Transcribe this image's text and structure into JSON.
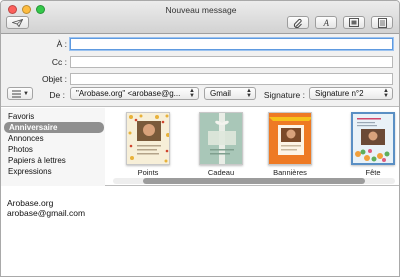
{
  "window": {
    "title": "Nouveau message"
  },
  "toolbar": {
    "send_icon": "paper-plane-icon",
    "attach_icon": "paperclip-icon",
    "format_icon": "font-a-icon",
    "photo_icon": "photo-browser-icon",
    "template_icon": "stationery-icon"
  },
  "fields": {
    "to_label": "À :",
    "cc_label": "Cc :",
    "subject_label": "Objet :",
    "to_value": "",
    "cc_value": "",
    "subject_value": "",
    "from_label": "De :",
    "from_value": "\"Arobase.org\" <arobase@g...",
    "account_value": "Gmail",
    "signature_label": "Signature :",
    "signature_value": "Signature n°2"
  },
  "stationery": {
    "categories": [
      "Favoris",
      "Anniversaire",
      "Annonces",
      "Photos",
      "Papiers à lettres",
      "Expressions"
    ],
    "selected_category": "Anniversaire",
    "templates": [
      "Points",
      "Cadeau",
      "Bannières",
      "Fête"
    ]
  },
  "message": {
    "signature_lines": [
      "Arobase.org",
      "arobase@gmail.com"
    ]
  },
  "colors": {
    "accent_focus": "#5e9ae0",
    "selected_category_bg": "#8f8f8f",
    "close": "#fc605c",
    "minimize": "#fdbc40",
    "zoom": "#34c84a"
  }
}
